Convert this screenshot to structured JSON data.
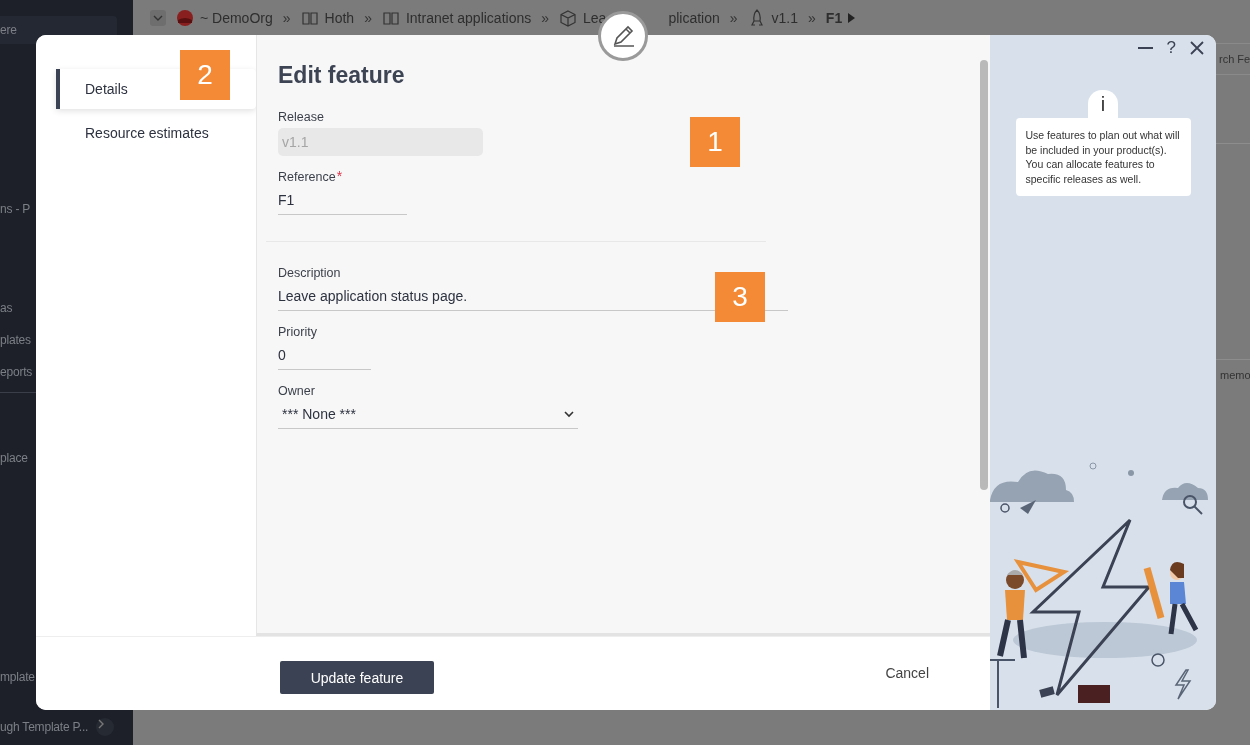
{
  "background": {
    "sidebar_items": [
      "ere",
      "ns - P",
      "as",
      "plates",
      "eports",
      "place",
      "mplate",
      "ugh Template P..."
    ],
    "breadcrumb": [
      {
        "kind": "org",
        "label": "~ DemoOrg",
        "separator": "»"
      },
      {
        "kind": "book",
        "label": "Hoth",
        "separator": "»"
      },
      {
        "kind": "book",
        "label": "Intranet applications",
        "separator": "»"
      },
      {
        "kind": "box",
        "label": "Lea",
        "label_after": "plication",
        "separator": "»"
      },
      {
        "kind": "rocket",
        "label": "v1.1",
        "separator": "»"
      },
      {
        "kind": "current",
        "label": "F1"
      }
    ],
    "search_text": "rch Fe",
    "side_text": "memo"
  },
  "dialog": {
    "title": "Edit feature",
    "nav": [
      {
        "label": "Details",
        "selected": true
      },
      {
        "label": "Resource estimates",
        "selected": false
      }
    ],
    "fields": [
      {
        "kind": "text",
        "label": "Release",
        "value": "v1.1",
        "disabled": true
      },
      {
        "kind": "text",
        "label": "Reference",
        "required_mark": "*",
        "value": "F1",
        "disabled": false
      },
      {
        "kind": "divider"
      },
      {
        "kind": "text",
        "label": "Description",
        "value": "Leave application status page.",
        "disabled": false
      },
      {
        "kind": "text",
        "label": "Priority",
        "value": "0",
        "disabled": false
      },
      {
        "kind": "select",
        "label": "Owner",
        "value": "*** None ***",
        "disabled": false
      }
    ],
    "primary_button": "Update feature",
    "cancel_button": "Cancel",
    "help_glyph": "?",
    "info_glyph": "i",
    "help_text": "Use features to plan out what will be included in your product(s). You can allocate features to specific releases as well."
  },
  "callouts": [
    "1",
    "2",
    "3"
  ]
}
